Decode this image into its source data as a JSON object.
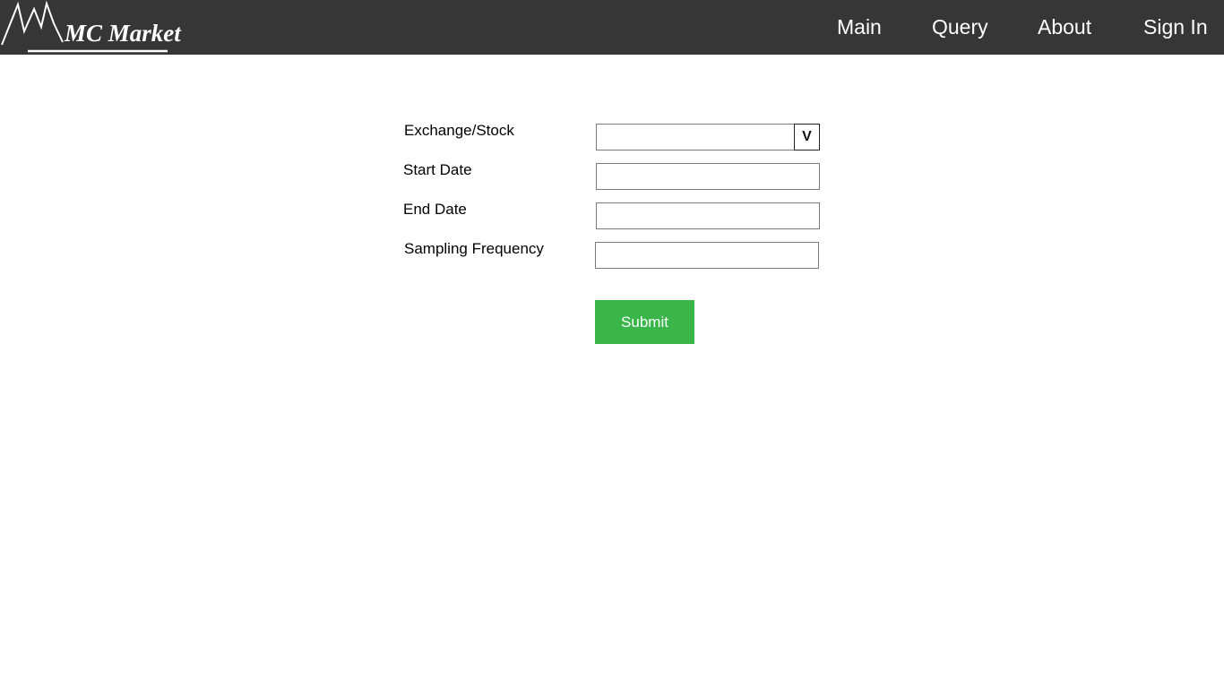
{
  "header": {
    "logo_text": "MC Market",
    "nav": {
      "main": "Main",
      "query": "Query",
      "about": "About",
      "signin": "Sign In"
    },
    "background_color": "#363636"
  },
  "form": {
    "exchange_label": "Exchange/Stock",
    "exchange_value": "",
    "dropdown_glyph": "V",
    "start_date_label": "Start Date",
    "start_date_value": "",
    "end_date_label": "End Date",
    "end_date_value": "",
    "sampling_label": "Sampling Frequency",
    "sampling_value": "",
    "submit_label": "Submit",
    "submit_color": "#39b54a"
  },
  "icons": {
    "logo": "mountain-peaks-logo",
    "dropdown": "chevron-down-icon"
  }
}
